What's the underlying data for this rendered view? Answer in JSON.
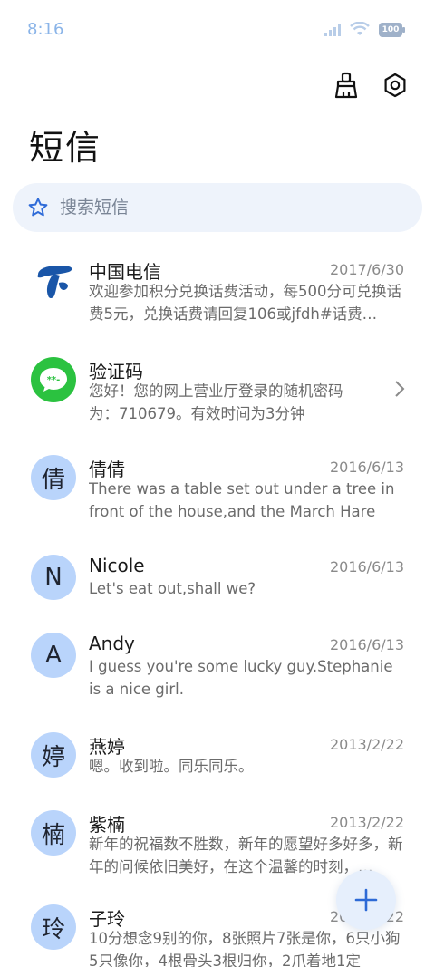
{
  "status": {
    "time": "8:16",
    "battery": "100"
  },
  "title": "短信",
  "search": {
    "placeholder": "搜索短信"
  },
  "messages": [
    {
      "name": "中国电信",
      "date": "2017/6/30",
      "preview": "欢迎参加积分兑换话费活动，每500分可兑换话费5元，兑换话费请回复106或jfdh#话费…",
      "avatar": "telecom-logo"
    },
    {
      "name": "验证码",
      "date": "",
      "preview": "您好！您的网上营业厅登录的随机密码为：710679。有效时间为3分钟",
      "avatar": "message-bubble"
    },
    {
      "name": "倩倩",
      "date": "2016/6/13",
      "preview": "There was a table set out under a tree in front of the house,and the March Hare an…",
      "avatar": "倩"
    },
    {
      "name": "Nicole",
      "date": "2016/6/13",
      "preview": "Let's eat out,shall we?",
      "avatar": "N"
    },
    {
      "name": "Andy",
      "date": "2016/6/13",
      "preview": "I guess you're some lucky guy.Stephanie is a nice girl.",
      "avatar": "A"
    },
    {
      "name": "燕婷",
      "date": "2013/2/22",
      "preview": "嗯。收到啦。同乐同乐。",
      "avatar": "婷"
    },
    {
      "name": "紫楠",
      "date": "2013/2/22",
      "preview": "新年的祝福数不胜数，新年的愿望好多好多，新年的问候依旧美好，在这个温馨的时刻，…",
      "avatar": "楠"
    },
    {
      "name": "子玲",
      "date": "2013/2/22",
      "preview": "10分想念9别的你，8张照片7张是你，6只小狗5只像你，4根骨头3根归你，2爪着地1定",
      "avatar": "玲"
    }
  ]
}
